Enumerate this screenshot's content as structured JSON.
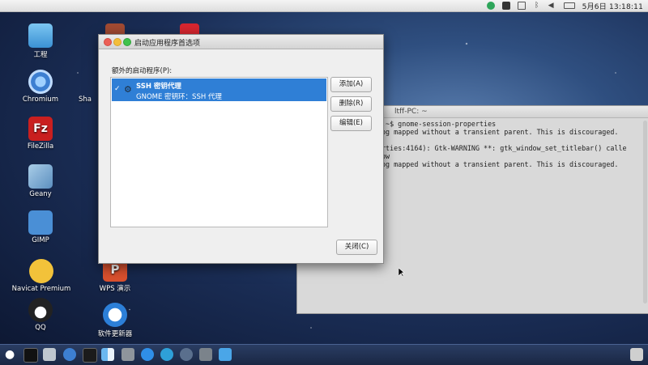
{
  "topbar": {
    "clock": "5月6日 13:18:11"
  },
  "desktop": {
    "icons": [
      {
        "label": "工程",
        "color": "#4aa6e8"
      },
      {
        "label": "Chromium",
        "color": "#3d7fd1"
      },
      {
        "label": "Sha",
        "color": "#b04a3a"
      },
      {
        "label": "FileZilla",
        "color": "#c91f1f"
      },
      {
        "label": "Geany",
        "color": "#7fb0d8"
      },
      {
        "label": "GIMP",
        "color": "#4a8fd6"
      },
      {
        "label": "Navicat Premium",
        "color": "#f2c23a"
      },
      {
        "label": "QQ",
        "color": "#222222"
      },
      {
        "label": "WPS 演示",
        "color": "#d9502e"
      },
      {
        "label": "软件更新器",
        "color": "#2c7fd8"
      }
    ]
  },
  "terminal": {
    "title": "ltff-PC: ~",
    "lines": [
      ":~$ gnome-session-properties",
      "og mapped without a transient parent. This is discouraged.",
      "",
      "rties:4164): Gtk-WARNING **: gtk_window_set_titlebar() calle",
      "ow",
      "og mapped without a transient parent. This is discouraged."
    ]
  },
  "dialog": {
    "title": "启动应用程序首选项",
    "section_label": "额外的启动程序(P):",
    "entry": {
      "name": "SSH 密钥代理",
      "description": "GNOME 密钥环：SSH 代理",
      "checked": "✓"
    },
    "buttons": {
      "add": "添加(A)",
      "remove": "删除(R)",
      "edit": "编辑(E)",
      "close": "关闭(C)"
    }
  },
  "dock": {
    "items": [
      "apple",
      "terminal",
      "editor",
      "finder",
      "monitor",
      "files",
      "settings",
      "appstore",
      "telegram",
      "browser",
      "settings2",
      "launcher"
    ]
  }
}
